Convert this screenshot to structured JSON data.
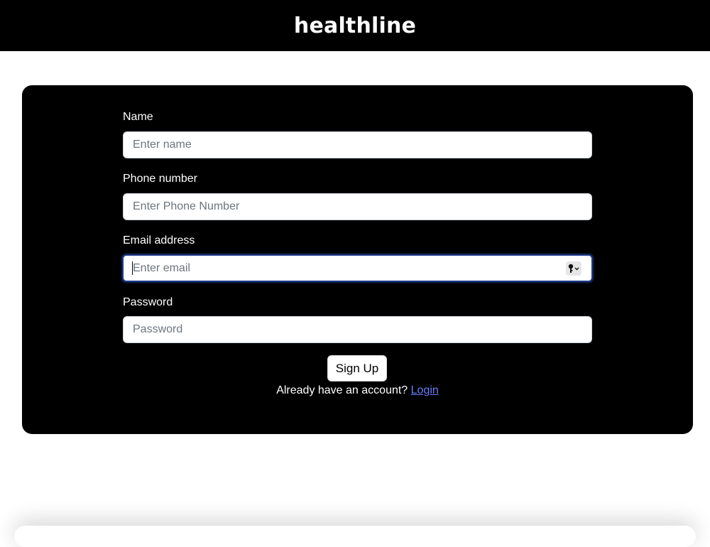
{
  "header": {
    "brand": "healthline"
  },
  "form": {
    "name": {
      "label": "Name",
      "placeholder": "Enter name"
    },
    "phone": {
      "label": "Phone number",
      "placeholder": "Enter Phone Number"
    },
    "email": {
      "label": "Email address",
      "placeholder": "Enter email"
    },
    "password": {
      "label": "Password",
      "placeholder": "Password"
    },
    "signup_label": "Sign Up",
    "account_prompt": "Already have an account?",
    "login_link": "Login"
  },
  "colors": {
    "header_bg": "#000000",
    "card_bg": "#000000",
    "link": "#6a7cf6",
    "focus_ring": "#1d3b8a"
  },
  "icons": {
    "password_manager": "key-icon"
  }
}
